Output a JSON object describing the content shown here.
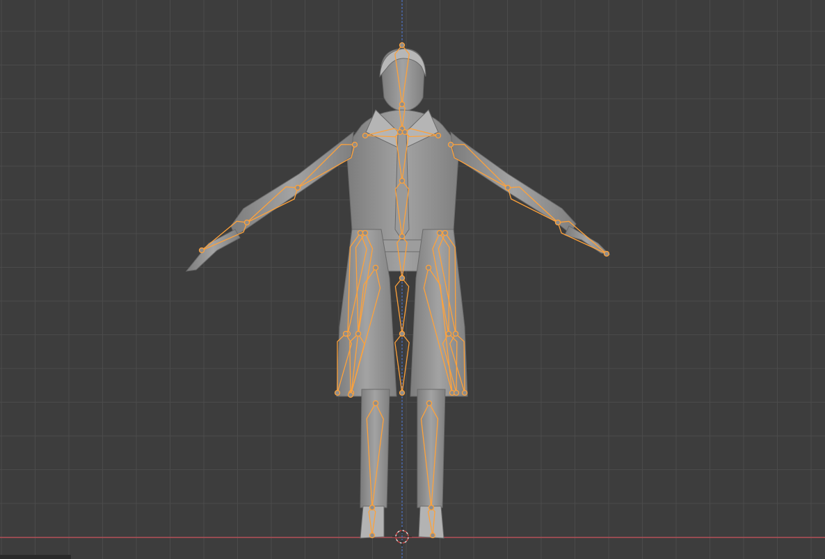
{
  "app": {
    "name": "3D Viewport"
  },
  "viewport": {
    "background": "#3d3d3d",
    "grid_color": "#4a4a4a",
    "axis_x_color": "#c8505a",
    "axis_z_color": "#4e72c0",
    "mesh_color": "#8d8d8d",
    "mesh_shade": "#a8a8a8",
    "bone_color": "#ffa23a"
  },
  "scene": {
    "mesh_object": "body-mesh",
    "armature_object": "armature",
    "cursor": "3d-cursor"
  }
}
